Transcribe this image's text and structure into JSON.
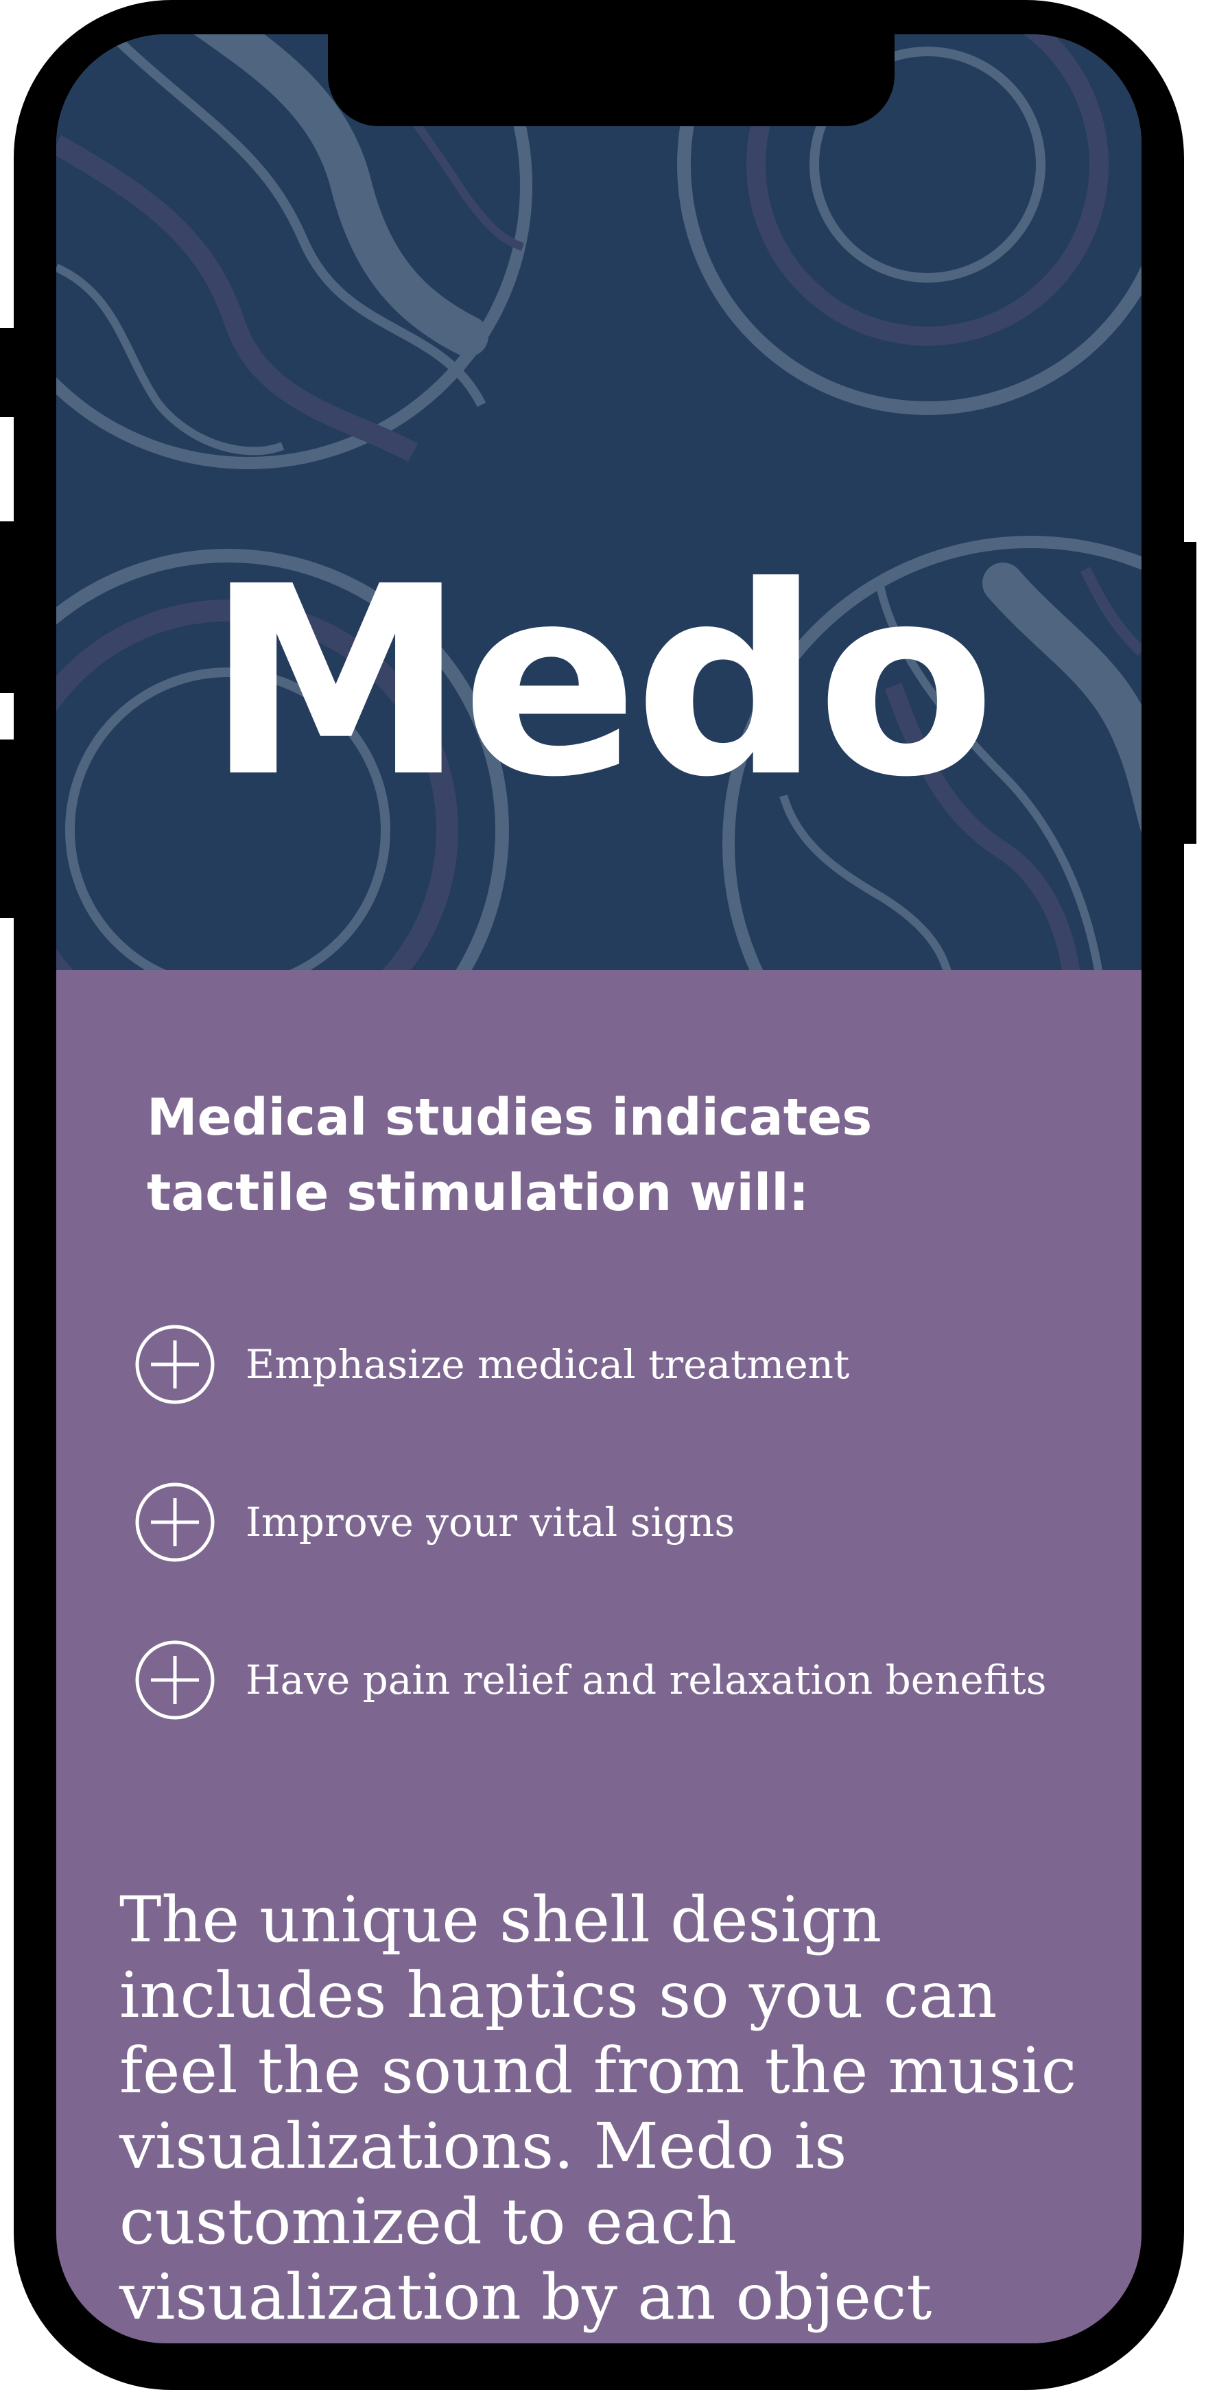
{
  "hero": {
    "title": "Medo"
  },
  "intro": {
    "heading": "Medical studies indicates tactile stimulation will:"
  },
  "benefits": {
    "items": [
      {
        "icon": "plus-circle-icon",
        "label": "Emphasize medical treatment"
      },
      {
        "icon": "plus-circle-icon",
        "label": "Improve your vital signs"
      },
      {
        "icon": "plus-circle-icon",
        "label": "Have pain relief and relaxation benefits"
      }
    ]
  },
  "description": {
    "text": "The unique shell design includes haptics so you can feel the sound from the music visualizations. Medo is customized to each visualization by an object characterizing the cadence in"
  },
  "colors": {
    "hero_background": "#243d5c",
    "content_background": "#7d6790",
    "decor_light": "#4f6580",
    "decor_muted": "#3a4467",
    "text": "#ffffff",
    "frame": "#000000"
  }
}
